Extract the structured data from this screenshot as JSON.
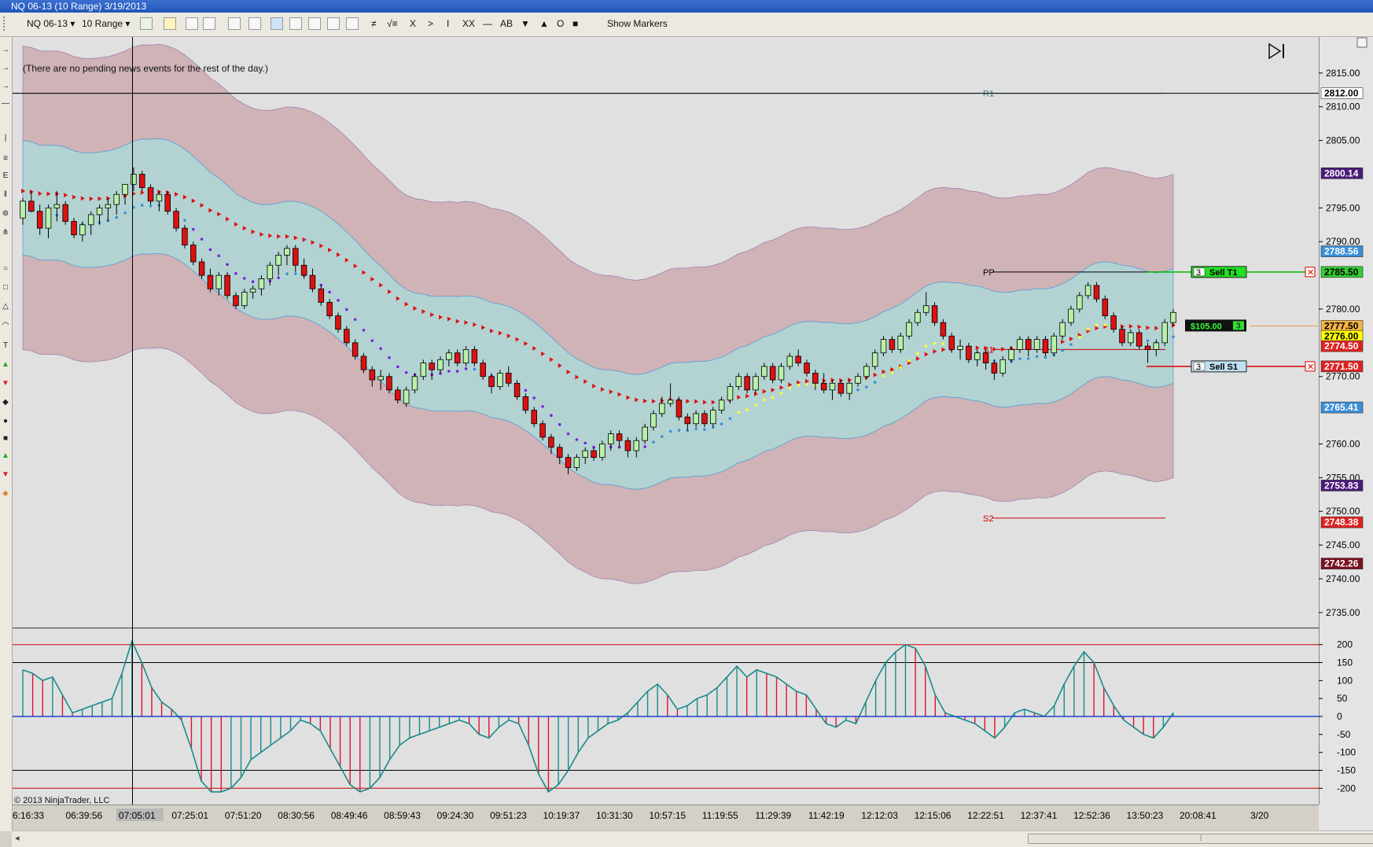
{
  "window": {
    "title": "NQ 06-13 (10 Range)  3/19/2013"
  },
  "toolbar": {
    "instrument": "NQ 06-13",
    "range": "10 Range",
    "buttons": [
      "≠",
      "√≡",
      "X",
      ">",
      "I",
      "XX",
      "—",
      "AB",
      "▼",
      "▲",
      "O",
      "■"
    ],
    "show_markers": "Show Markers"
  },
  "news_text": "(There are no pending news events for the rest of the day.)",
  "copyright": "© 2013 NinjaTrader, LLC",
  "chart_data": [
    {
      "type": "candlestick",
      "title": "",
      "ylim": [
        2733.0,
        2820.0
      ],
      "y_ticks": [
        2815,
        2810,
        2805,
        2795,
        2790,
        2780,
        2770,
        2760,
        2755,
        2750,
        2745,
        2740,
        2735
      ],
      "y_tick_labels": [
        "2815.00",
        "2810.00",
        "2805.00",
        "2795.00",
        "2790.00",
        "2780.00",
        "2770.00",
        "2760.00",
        "2755.00",
        "2750.00",
        "2745.00",
        "2740.00",
        "2735.00"
      ],
      "x_tick_labels": [
        "6:16:33",
        "06:39:56",
        "07:05:01",
        "07:25:01",
        "07:51:20",
        "08:30:56",
        "08:49:46",
        "08:59:43",
        "09:24:30",
        "09:51:23",
        "10:19:37",
        "10:31:30",
        "10:57:15",
        "11:19:55",
        "11:29:39",
        "11:42:19",
        "12:12:03",
        "12:15:06",
        "12:22:51",
        "12:37:41",
        "12:52:36",
        "13:50:23",
        "20:08:41",
        "3/20"
      ],
      "highlighted_x_label": "07:05:01",
      "crosshair_price": 2812.0,
      "levels": [
        {
          "name": "R1",
          "price": 2812.0,
          "color": "#2e7d7d"
        },
        {
          "name": "PP",
          "price": 2785.5,
          "color": "#000000"
        },
        {
          "name": "S1",
          "price": 2774.0,
          "color": "#cc0000"
        },
        {
          "name": "S2",
          "price": 2749.0,
          "color": "#cc0000"
        }
      ],
      "price_markers": [
        {
          "label": "2812.00",
          "price": 2812.0,
          "bg": "#ffffff",
          "fg": "#000000"
        },
        {
          "label": "2800.14",
          "price": 2800.14,
          "bg": "#4b1a7a",
          "fg": "#ffffff"
        },
        {
          "label": "2788.56",
          "price": 2788.56,
          "bg": "#3b8fd6",
          "fg": "#ffffff"
        },
        {
          "label": "2785.50",
          "price": 2785.5,
          "bg": "#33cc33",
          "fg": "#000000"
        },
        {
          "label": "2777.50",
          "price": 2777.5,
          "bg": "#f5b342",
          "fg": "#000000"
        },
        {
          "label": "2776.00",
          "price": 2776.0,
          "bg": "#ffff00",
          "fg": "#000000"
        },
        {
          "label": "2774.50",
          "price": 2774.5,
          "bg": "#dd2222",
          "fg": "#ffffff"
        },
        {
          "label": "2771.50",
          "price": 2771.5,
          "bg": "#dd2222",
          "fg": "#ffffff"
        },
        {
          "label": "2765.41",
          "price": 2765.41,
          "bg": "#3b8fd6",
          "fg": "#ffffff"
        },
        {
          "label": "2753.83",
          "price": 2753.83,
          "bg": "#4b1a7a",
          "fg": "#ffffff"
        },
        {
          "label": "2748.38",
          "price": 2748.38,
          "bg": "#dd2222",
          "fg": "#ffffff"
        },
        {
          "label": "2742.26",
          "price": 2742.26,
          "bg": "#7a1020",
          "fg": "#ffffff"
        }
      ],
      "orders": [
        {
          "qty": "3",
          "label": "Sell T1",
          "price": 2785.5,
          "color": "#22dd22",
          "line": "#00bb00"
        },
        {
          "qty": "3",
          "label": "Sell S1",
          "price": 2771.5,
          "color": "#bfe0f0",
          "line": "#dd0000"
        }
      ],
      "position": {
        "pnl": "$105.00",
        "qty": "3",
        "price": 2777.5
      },
      "candles": [
        [
          2793.5,
          2796.5,
          2792.5,
          2796.0
        ],
        [
          2796.0,
          2797.5,
          2794.5,
          2794.5
        ],
        [
          2794.5,
          2795.5,
          2791.0,
          2792.0
        ],
        [
          2792.0,
          2795.5,
          2790.5,
          2795.0
        ],
        [
          2795.0,
          2797.5,
          2793.0,
          2795.5
        ],
        [
          2795.5,
          2796.0,
          2792.5,
          2793.0
        ],
        [
          2793.0,
          2793.5,
          2790.5,
          2791.0
        ],
        [
          2791.0,
          2793.0,
          2790.0,
          2792.5
        ],
        [
          2792.5,
          2794.5,
          2791.0,
          2794.0
        ],
        [
          2794.0,
          2795.5,
          2792.5,
          2795.0
        ],
        [
          2795.0,
          2796.5,
          2793.0,
          2795.5
        ],
        [
          2795.5,
          2797.5,
          2794.0,
          2797.0
        ],
        [
          2797.0,
          2798.5,
          2795.5,
          2798.5
        ],
        [
          2798.5,
          2801.0,
          2797.5,
          2800.0
        ],
        [
          2800.0,
          2800.5,
          2797.5,
          2798.0
        ],
        [
          2798.0,
          2798.5,
          2795.5,
          2796.0
        ],
        [
          2796.0,
          2797.5,
          2794.5,
          2797.0
        ],
        [
          2797.0,
          2797.5,
          2794.0,
          2794.5
        ],
        [
          2794.5,
          2795.0,
          2791.5,
          2792.0
        ],
        [
          2792.0,
          2792.5,
          2789.0,
          2789.5
        ],
        [
          2789.5,
          2790.0,
          2786.5,
          2787.0
        ],
        [
          2787.0,
          2787.5,
          2784.5,
          2785.0
        ],
        [
          2785.0,
          2786.0,
          2782.5,
          2783.0
        ],
        [
          2783.0,
          2785.5,
          2782.0,
          2785.0
        ],
        [
          2785.0,
          2785.5,
          2781.5,
          2782.0
        ],
        [
          2782.0,
          2782.5,
          2780.0,
          2780.5
        ],
        [
          2780.5,
          2783.0,
          2780.0,
          2782.5
        ],
        [
          2782.5,
          2783.5,
          2781.5,
          2783.0
        ],
        [
          2783.0,
          2785.0,
          2782.0,
          2784.5
        ],
        [
          2784.5,
          2787.0,
          2783.5,
          2786.5
        ],
        [
          2786.5,
          2788.5,
          2785.0,
          2788.0
        ],
        [
          2788.0,
          2789.5,
          2786.5,
          2789.0
        ],
        [
          2789.0,
          2789.5,
          2785.5,
          2786.5
        ],
        [
          2786.5,
          2787.5,
          2784.5,
          2785.0
        ],
        [
          2785.0,
          2786.0,
          2782.5,
          2783.0
        ],
        [
          2783.0,
          2783.5,
          2780.5,
          2781.0
        ],
        [
          2781.0,
          2781.5,
          2778.5,
          2779.0
        ],
        [
          2779.0,
          2779.5,
          2776.5,
          2777.0
        ],
        [
          2777.0,
          2777.5,
          2774.5,
          2775.0
        ],
        [
          2775.0,
          2775.5,
          2772.5,
          2773.0
        ],
        [
          2773.0,
          2773.5,
          2770.5,
          2771.0
        ],
        [
          2771.0,
          2771.5,
          2768.5,
          2769.5
        ],
        [
          2769.5,
          2771.0,
          2768.0,
          2770.0
        ],
        [
          2770.0,
          2770.5,
          2767.5,
          2768.0
        ],
        [
          2768.0,
          2768.5,
          2766.0,
          2766.5
        ],
        [
          2766.0,
          2768.5,
          2765.5,
          2768.0
        ],
        [
          2768.0,
          2770.5,
          2767.5,
          2770.0
        ],
        [
          2770.0,
          2772.5,
          2769.5,
          2772.0
        ],
        [
          2772.0,
          2772.5,
          2769.5,
          2771.0
        ],
        [
          2771.0,
          2773.0,
          2770.5,
          2772.5
        ],
        [
          2772.5,
          2774.0,
          2771.5,
          2773.5
        ],
        [
          2773.5,
          2774.0,
          2771.5,
          2772.0
        ],
        [
          2772.0,
          2774.5,
          2771.5,
          2774.0
        ],
        [
          2774.0,
          2774.5,
          2771.5,
          2772.0
        ],
        [
          2772.0,
          2772.5,
          2769.5,
          2770.0
        ],
        [
          2770.0,
          2770.5,
          2767.5,
          2768.5
        ],
        [
          2768.5,
          2771.0,
          2768.0,
          2770.5
        ],
        [
          2770.5,
          2771.5,
          2768.5,
          2769.0
        ],
        [
          2769.0,
          2769.5,
          2766.5,
          2767.0
        ],
        [
          2767.0,
          2767.5,
          2764.5,
          2765.0
        ],
        [
          2765.0,
          2765.5,
          2762.5,
          2763.0
        ],
        [
          2763.0,
          2763.5,
          2760.5,
          2761.0
        ],
        [
          2761.0,
          2761.5,
          2758.5,
          2759.5
        ],
        [
          2759.5,
          2760.0,
          2757.0,
          2758.0
        ],
        [
          2758.0,
          2758.5,
          2755.5,
          2756.5
        ],
        [
          2756.5,
          2758.5,
          2756.0,
          2758.0
        ],
        [
          2758.0,
          2759.5,
          2757.0,
          2759.0
        ],
        [
          2759.0,
          2759.5,
          2757.5,
          2758.0
        ],
        [
          2758.0,
          2760.5,
          2757.5,
          2760.0
        ],
        [
          2760.0,
          2762.0,
          2759.0,
          2761.5
        ],
        [
          2761.5,
          2762.0,
          2759.5,
          2760.5
        ],
        [
          2760.5,
          2761.0,
          2758.0,
          2759.0
        ],
        [
          2759.0,
          2761.0,
          2758.0,
          2760.5
        ],
        [
          2760.5,
          2763.0,
          2760.0,
          2762.5
        ],
        [
          2762.5,
          2765.0,
          2762.0,
          2764.5
        ],
        [
          2764.5,
          2767.0,
          2764.0,
          2766.0
        ],
        [
          2766.0,
          2769.0,
          2765.5,
          2766.5
        ],
        [
          2766.5,
          2767.0,
          2763.5,
          2764.0
        ],
        [
          2764.0,
          2764.5,
          2762.0,
          2763.0
        ],
        [
          2763.0,
          2765.0,
          2762.5,
          2764.5
        ],
        [
          2764.5,
          2765.0,
          2762.5,
          2763.0
        ],
        [
          2763.0,
          2765.5,
          2762.5,
          2765.0
        ],
        [
          2765.0,
          2767.0,
          2764.5,
          2766.5
        ],
        [
          2766.5,
          2769.0,
          2766.0,
          2768.5
        ],
        [
          2768.5,
          2770.5,
          2768.0,
          2770.0
        ],
        [
          2770.0,
          2770.5,
          2767.5,
          2768.0
        ],
        [
          2768.0,
          2770.5,
          2767.5,
          2770.0
        ],
        [
          2770.0,
          2772.0,
          2769.5,
          2771.5
        ],
        [
          2771.5,
          2772.0,
          2769.0,
          2769.5
        ],
        [
          2769.5,
          2772.0,
          2769.0,
          2771.5
        ],
        [
          2771.5,
          2773.5,
          2771.0,
          2773.0
        ],
        [
          2773.0,
          2774.0,
          2771.5,
          2772.0
        ],
        [
          2772.0,
          2772.5,
          2770.0,
          2770.5
        ],
        [
          2770.5,
          2771.0,
          2768.0,
          2769.0
        ],
        [
          2769.0,
          2770.5,
          2767.5,
          2768.0
        ],
        [
          2768.0,
          2769.5,
          2766.5,
          2769.0
        ],
        [
          2769.0,
          2769.5,
          2767.0,
          2767.5
        ],
        [
          2767.5,
          2769.5,
          2766.5,
          2769.0
        ],
        [
          2769.0,
          2770.5,
          2768.5,
          2770.0
        ],
        [
          2770.0,
          2772.0,
          2769.5,
          2771.5
        ],
        [
          2771.5,
          2774.0,
          2771.0,
          2773.5
        ],
        [
          2773.5,
          2776.0,
          2773.0,
          2775.5
        ],
        [
          2775.5,
          2776.0,
          2773.5,
          2774.0
        ],
        [
          2774.0,
          2776.5,
          2773.5,
          2776.0
        ],
        [
          2776.0,
          2778.5,
          2775.5,
          2778.0
        ],
        [
          2778.0,
          2780.0,
          2777.5,
          2779.5
        ],
        [
          2779.5,
          2782.5,
          2779.0,
          2780.5
        ],
        [
          2780.5,
          2781.0,
          2777.5,
          2778.0
        ],
        [
          2778.0,
          2778.5,
          2775.5,
          2776.0
        ],
        [
          2776.0,
          2776.5,
          2773.5,
          2774.0
        ],
        [
          2774.0,
          2775.5,
          2772.5,
          2774.5
        ],
        [
          2774.5,
          2775.0,
          2772.0,
          2772.5
        ],
        [
          2772.5,
          2774.0,
          2771.5,
          2773.5
        ],
        [
          2773.5,
          2774.0,
          2771.0,
          2772.0
        ],
        [
          2772.0,
          2772.5,
          2769.5,
          2770.5
        ],
        [
          2770.5,
          2773.0,
          2770.0,
          2772.5
        ],
        [
          2772.5,
          2774.5,
          2772.0,
          2774.0
        ],
        [
          2774.0,
          2776.0,
          2773.5,
          2775.5
        ],
        [
          2775.5,
          2776.0,
          2773.0,
          2774.0
        ],
        [
          2774.0,
          2776.0,
          2773.5,
          2775.5
        ],
        [
          2775.5,
          2776.0,
          2773.0,
          2773.5
        ],
        [
          2773.5,
          2776.5,
          2773.0,
          2776.0
        ],
        [
          2776.0,
          2778.5,
          2775.5,
          2778.0
        ],
        [
          2778.0,
          2780.5,
          2777.5,
          2780.0
        ],
        [
          2780.0,
          2782.5,
          2779.5,
          2782.0
        ],
        [
          2782.0,
          2784.0,
          2781.5,
          2783.5
        ],
        [
          2783.5,
          2784.0,
          2781.0,
          2781.5
        ],
        [
          2781.5,
          2782.0,
          2778.5,
          2779.0
        ],
        [
          2779.0,
          2779.5,
          2776.5,
          2777.0
        ],
        [
          2777.0,
          2777.5,
          2774.5,
          2775.0
        ],
        [
          2775.0,
          2777.0,
          2774.5,
          2776.5
        ],
        [
          2776.5,
          2777.0,
          2774.0,
          2774.5
        ],
        [
          2774.5,
          2775.0,
          2772.0,
          2774.0
        ],
        [
          2774.0,
          2775.5,
          2773.0,
          2775.0
        ],
        [
          2775.0,
          2778.5,
          2774.5,
          2778.0
        ],
        [
          2778.0,
          2780.0,
          2777.5,
          2779.5
        ]
      ],
      "lower_panel": {
        "type": "histogram",
        "ylim": [
          -230,
          230
        ],
        "y_ticks": [
          200,
          150,
          100,
          50,
          0,
          -50,
          -100,
          -150,
          -200
        ],
        "y_tick_labels": [
          "200",
          "150",
          "100",
          "50",
          "0",
          "-50",
          "-100",
          "-150",
          "-200"
        ],
        "ref_lines": [
          {
            "value": 200,
            "color": "#cc0000"
          },
          {
            "value": 150,
            "color": "#000000"
          },
          {
            "value": 0,
            "color": "#000000"
          },
          {
            "value": -150,
            "color": "#000000"
          },
          {
            "value": -200,
            "color": "#cc0000"
          }
        ],
        "values": [
          130,
          120,
          100,
          110,
          60,
          10,
          20,
          30,
          40,
          50,
          120,
          210,
          150,
          80,
          40,
          20,
          -10,
          -90,
          -180,
          -210,
          -210,
          -200,
          -170,
          -120,
          -100,
          -80,
          -60,
          -40,
          -10,
          -20,
          -40,
          -90,
          -140,
          -190,
          -210,
          -200,
          -170,
          -120,
          -80,
          -60,
          -50,
          -40,
          -30,
          -20,
          -10,
          -20,
          -50,
          -60,
          -30,
          -10,
          -20,
          -80,
          -160,
          -210,
          -190,
          -150,
          -100,
          -60,
          -40,
          -20,
          -10,
          10,
          40,
          70,
          90,
          60,
          20,
          30,
          50,
          60,
          80,
          110,
          140,
          110,
          130,
          120,
          110,
          90,
          70,
          60,
          20,
          -20,
          -30,
          -10,
          -20,
          40,
          100,
          150,
          180,
          200,
          190,
          140,
          60,
          10,
          0,
          -10,
          -20,
          -40,
          -60,
          -30,
          10,
          20,
          10,
          0,
          30,
          90,
          140,
          180,
          150,
          80,
          30,
          -10,
          -30,
          -50,
          -60,
          -30,
          10
        ]
      }
    }
  ]
}
